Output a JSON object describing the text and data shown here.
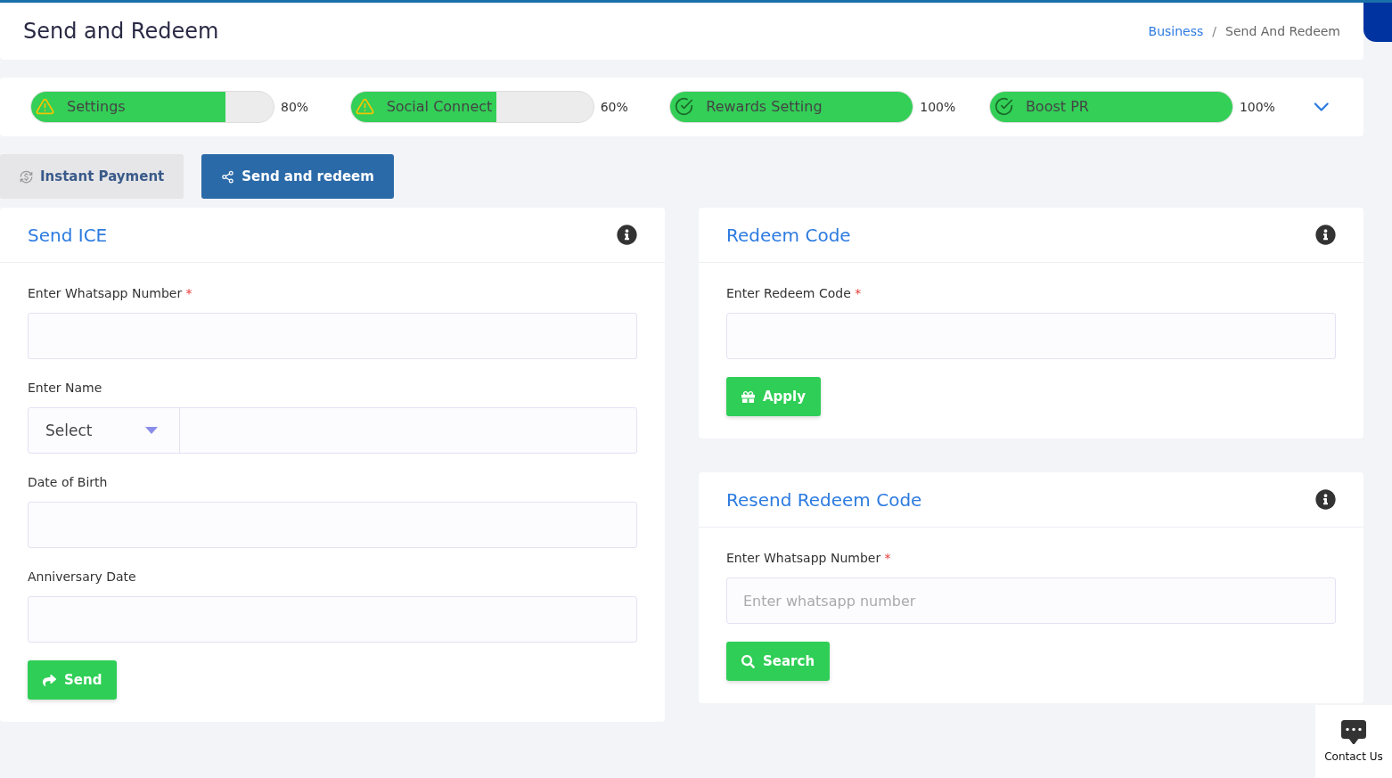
{
  "header": {
    "title": "Send and Redeem",
    "breadcrumb": [
      "Business",
      "Send And Redeem"
    ],
    "separator": "/"
  },
  "progress": [
    {
      "label": "Settings",
      "kind": "warning",
      "level": 0.8,
      "reading": "80%"
    },
    {
      "label": "Social Connect",
      "kind": "warning",
      "level": 0.6,
      "reading": "60%"
    },
    {
      "label": "Rewards Setting",
      "kind": "done",
      "level": 1,
      "reading": "100%"
    },
    {
      "label": "Boost PR",
      "kind": "done",
      "level": 1,
      "reading": "100%"
    }
  ],
  "tabs": [
    {
      "label": "Instant Payment",
      "selected": false
    },
    {
      "label": "Send and redeem",
      "selected": true
    }
  ],
  "left_card": {
    "title": "Send ICE",
    "fields": [
      {
        "kind": "text",
        "label": "Enter Whatsapp Number",
        "marker": "*"
      },
      {
        "kind": "select-text",
        "label": "Enter Name",
        "select": "Select"
      },
      {
        "kind": "text",
        "label": "Date of Birth"
      },
      {
        "kind": "text",
        "label": "Anniversary Date"
      }
    ],
    "button": "Send"
  },
  "right_cards": [
    {
      "title": "Redeem Code",
      "fields": [
        {
          "kind": "text",
          "label": "Enter Redeem Code",
          "marker": "*"
        }
      ],
      "button": "Apply"
    },
    {
      "title": "Resend Redeem Code",
      "fields": [
        {
          "kind": "text",
          "label": "Enter Whatsapp Number",
          "marker": "*",
          "placeholder": "Enter whatsapp number"
        }
      ],
      "button": "Search"
    }
  ],
  "contact": {
    "label": "Contact Us"
  }
}
